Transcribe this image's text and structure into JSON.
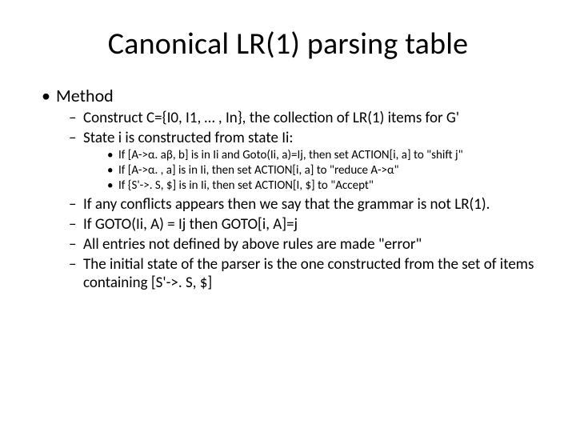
{
  "title": "Canonical LR(1) parsing table",
  "lvl1_0": "Method",
  "lvl2_0": "Construct C={I0, I1, … , In}, the collection of LR(1) items for G'",
  "lvl2_1": "State i is constructed from state Ii:",
  "lvl3_0": "If [A->α. aβ, b] is in Ii and Goto(Ii, a)=Ij, then set ACTION[i, a] to \"shift j\"",
  "lvl3_1": "If [A->α. , a] is in Ii, then set ACTION[i, a] to \"reduce A->α\"",
  "lvl3_2": "If {S'->. S, $] is in Ii, then set ACTION[I, $] to \"Accept\"",
  "lvl2_2": "If any conflicts appears then we say that the grammar is not LR(1).",
  "lvl2_3": "If GOTO(Ii, A) = Ij then GOTO[i, A]=j",
  "lvl2_4": "All entries not defined by above rules are made \"error\"",
  "lvl2_5": "The initial state of the parser is the one constructed from the set of items containing [S'->. S, $]"
}
